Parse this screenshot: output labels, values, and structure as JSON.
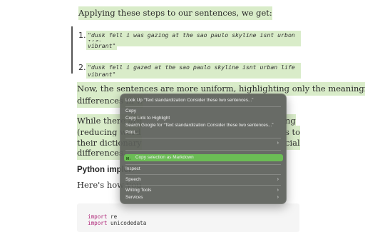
{
  "doc": {
    "intro": "Applying these steps to our sentences, we get:",
    "list": [
      {
        "num": "1.",
        "text": "\"dusk fell i was gazing at the sao paulo skyline isnt urbon life"
      },
      {
        "num": "",
        "text": "vibrant\""
      },
      {
        "num": "2.",
        "text": "\"dusk fell i gazed at the sao paulo skyline isnt urban life vibrant\""
      }
    ],
    "para2": [
      "Now, the sentences are more uniform, highlighting only the meaningful",
      "differences in w"
    ],
    "para3": [
      "While there are",
      "(reducing word",
      "their dictionary",
      "differences."
    ],
    "para3_right": [
      "ng",
      "s to",
      "cial"
    ],
    "heading": "Python implen",
    "para4": "Here's how you",
    "code": [
      {
        "kw": "import",
        "rest": " re"
      },
      {
        "kw": "import",
        "rest": " unicodedata"
      }
    ]
  },
  "context_menu": {
    "items": [
      {
        "label": "Look Up “Text standardization Consider these two sentences...”"
      },
      {
        "label": "Copy"
      },
      {
        "label": "Copy Link to Highlight"
      },
      {
        "label": "Search Google for “Text standardization Consider these two sentences...”"
      },
      {
        "label": "Print..."
      },
      {
        "label": "",
        "submenu": true
      },
      {
        "label": "Copy selection as Markdown",
        "selected": true,
        "icon": "markdown-icon",
        "icon_text": "M↓"
      },
      {
        "label": "Inspect"
      },
      {
        "label": "Speech",
        "submenu": true
      },
      {
        "label": "Writing Tools",
        "submenu": true
      },
      {
        "label": "Services",
        "submenu": true
      }
    ],
    "chevron": "›",
    "colors": {
      "menu_bg": "#5c605a",
      "selected": "#6bbd55",
      "highlight": "#d9ecc9"
    }
  }
}
